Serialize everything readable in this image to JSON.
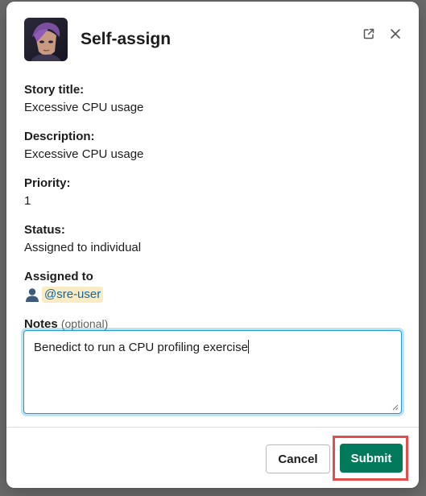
{
  "modal": {
    "title": "Self-assign"
  },
  "fields": [
    {
      "label": "Story title:",
      "value": "Excessive CPU usage"
    },
    {
      "label": "Description:",
      "value": "Excessive CPU usage"
    },
    {
      "label": "Priority:",
      "value": "1"
    },
    {
      "label": "Status:",
      "value": "Assigned to individual"
    }
  ],
  "assigned": {
    "label": "Assigned to",
    "user": "@sre-user",
    "icon": "user-icon"
  },
  "notes": {
    "label": "Notes",
    "optional": "(optional)",
    "value": "Benedict to run a CPU profiling exercise"
  },
  "footer": {
    "cancel_label": "Cancel",
    "submit_label": "Submit"
  },
  "colors": {
    "accent": "#007a5a",
    "mention_bg": "#f9ecc4",
    "mention_text": "#1264a3",
    "highlight": "#e24d4d",
    "focus": "#1d9bd1"
  }
}
